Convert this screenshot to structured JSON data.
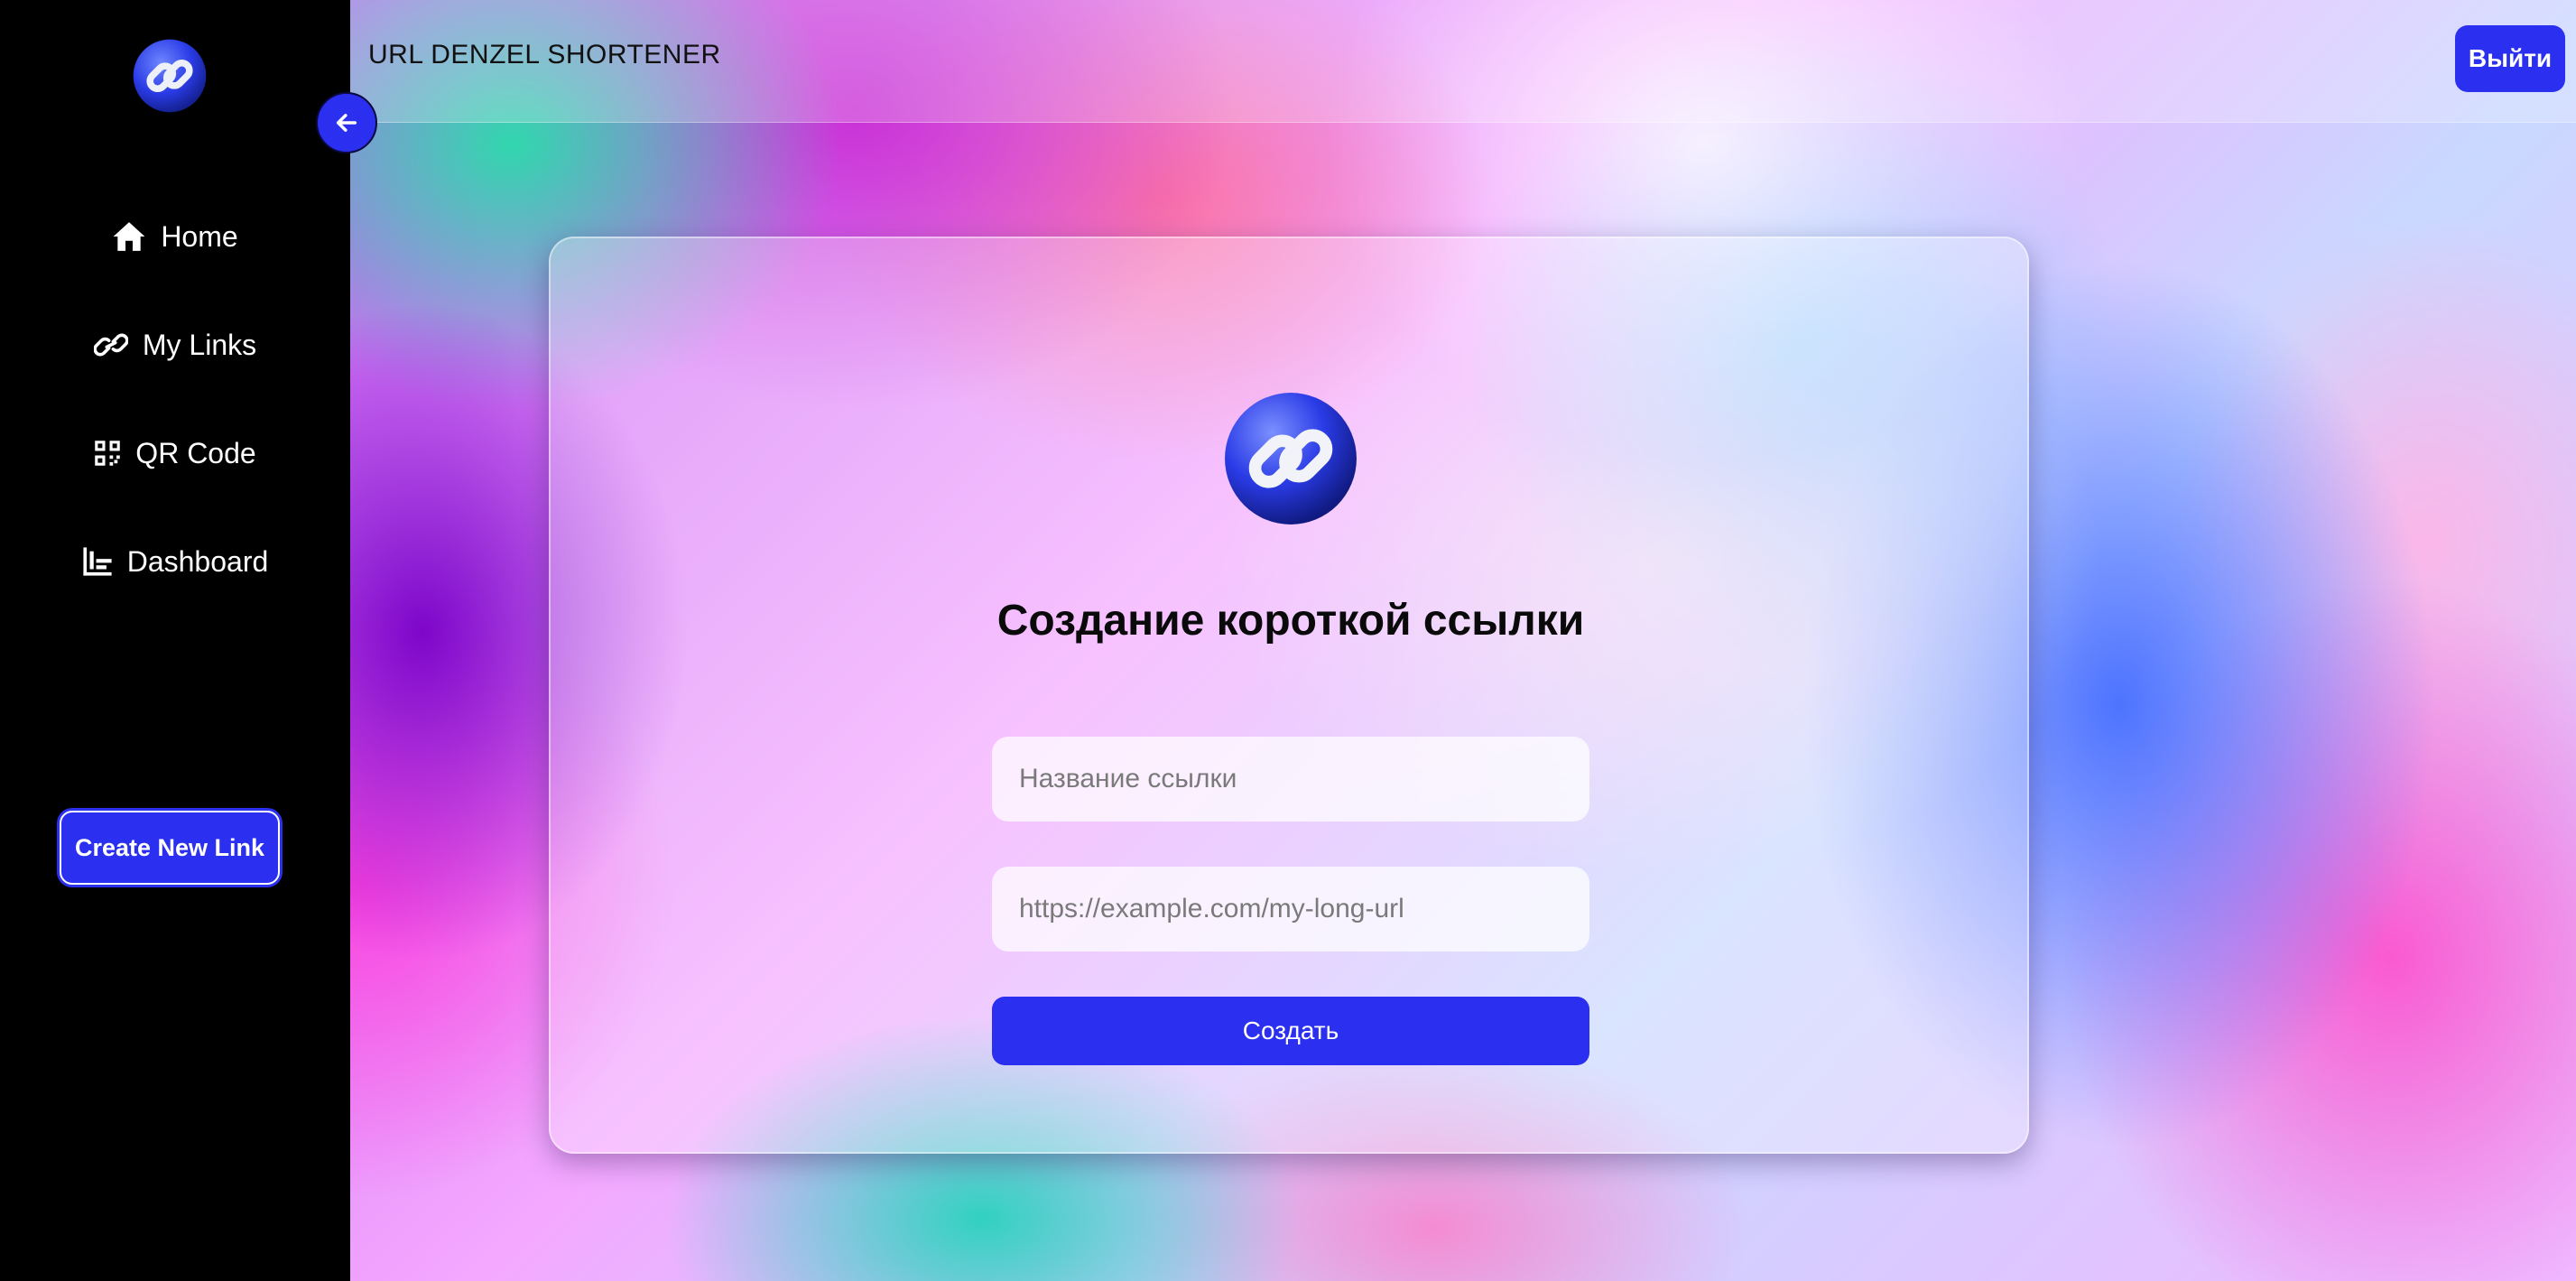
{
  "app": {
    "title": "URL DENZEL SHORTENER"
  },
  "header": {
    "logout_label": "Выйти"
  },
  "sidebar": {
    "logo_icon": "chain-link-icon",
    "collapse_icon": "arrow-left-icon",
    "items": [
      {
        "label": "Home",
        "icon": "home-icon"
      },
      {
        "label": "My Links",
        "icon": "link-icon"
      },
      {
        "label": "QR Code",
        "icon": "qr-code-icon"
      },
      {
        "label": "Dashboard",
        "icon": "bar-chart-icon"
      }
    ],
    "create_label": "Create New Link"
  },
  "form": {
    "title": "Создание короткой ссылки",
    "name_placeholder": "Название ссылки",
    "name_value": "",
    "url_placeholder": "https://example.com/my-long-url",
    "url_value": "",
    "submit_label": "Создать"
  },
  "colors": {
    "accent": "#2a2ff0",
    "sidebar_bg": "#000000",
    "text_dark": "#0a0a0a"
  }
}
